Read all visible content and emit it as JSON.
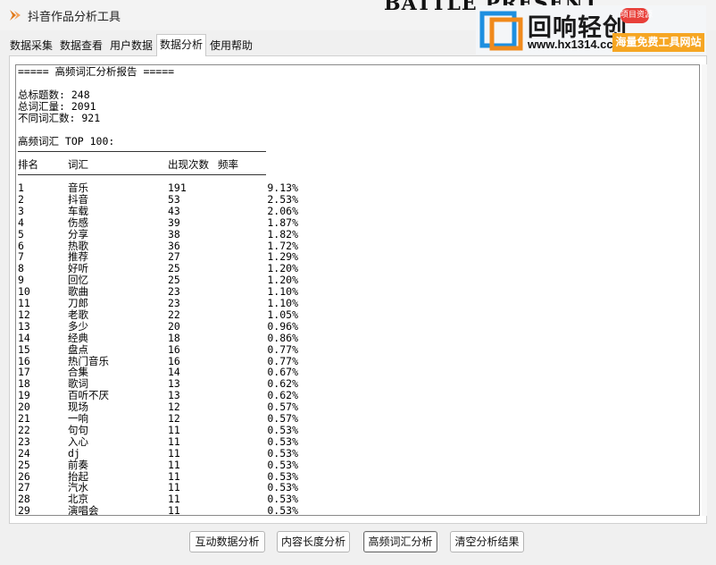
{
  "window": {
    "title": "抖音作品分析工具"
  },
  "background_partial_title": "BATTLE PRESENT",
  "tabs": [
    {
      "label": "数据采集",
      "active": false
    },
    {
      "label": "数据查看",
      "active": false
    },
    {
      "label": "用户数据",
      "active": false
    },
    {
      "label": "数据分析",
      "active": true
    },
    {
      "label": "使用帮助",
      "active": false
    }
  ],
  "banner": {
    "brand": "回响轻创",
    "badge": "项目资源",
    "url": "www.hx1314.cc",
    "slogan": "海量免费工具网站"
  },
  "report": {
    "heading": "===== 高频词汇分析报告 =====",
    "total_titles": "总标题数: 248",
    "total_words": "总词汇量: 2091",
    "unique_words": "不同词汇数: 921",
    "top_heading": "高频词汇 TOP 100:",
    "columns": {
      "rank": "排名",
      "word": "词汇",
      "count": "出现次数",
      "freq": "频率"
    },
    "rows": [
      {
        "rank": "1",
        "word": "音乐",
        "count": "191",
        "freq": "9.13%"
      },
      {
        "rank": "2",
        "word": "抖音",
        "count": "53",
        "freq": "2.53%"
      },
      {
        "rank": "3",
        "word": "车载",
        "count": "43",
        "freq": "2.06%"
      },
      {
        "rank": "4",
        "word": "伤感",
        "count": "39",
        "freq": "1.87%"
      },
      {
        "rank": "5",
        "word": "分享",
        "count": "38",
        "freq": "1.82%"
      },
      {
        "rank": "6",
        "word": "热歌",
        "count": "36",
        "freq": "1.72%"
      },
      {
        "rank": "7",
        "word": "推荐",
        "count": "27",
        "freq": "1.29%"
      },
      {
        "rank": "8",
        "word": "好听",
        "count": "25",
        "freq": "1.20%"
      },
      {
        "rank": "9",
        "word": "回忆",
        "count": "25",
        "freq": "1.20%"
      },
      {
        "rank": "10",
        "word": "歌曲",
        "count": "23",
        "freq": "1.10%"
      },
      {
        "rank": "11",
        "word": "刀郎",
        "count": "23",
        "freq": "1.10%"
      },
      {
        "rank": "12",
        "word": "老歌",
        "count": "22",
        "freq": "1.05%"
      },
      {
        "rank": "13",
        "word": "多少",
        "count": "20",
        "freq": "0.96%"
      },
      {
        "rank": "14",
        "word": "经典",
        "count": "18",
        "freq": "0.86%"
      },
      {
        "rank": "15",
        "word": "盘点",
        "count": "16",
        "freq": "0.77%"
      },
      {
        "rank": "16",
        "word": "热门音乐",
        "count": "16",
        "freq": "0.77%"
      },
      {
        "rank": "17",
        "word": "合集",
        "count": "14",
        "freq": "0.67%"
      },
      {
        "rank": "18",
        "word": "歌词",
        "count": "13",
        "freq": "0.62%"
      },
      {
        "rank": "19",
        "word": "百听不厌",
        "count": "13",
        "freq": "0.62%"
      },
      {
        "rank": "20",
        "word": "现场",
        "count": "12",
        "freq": "0.57%"
      },
      {
        "rank": "21",
        "word": "一响",
        "count": "12",
        "freq": "0.57%"
      },
      {
        "rank": "22",
        "word": "句句",
        "count": "11",
        "freq": "0.53%"
      },
      {
        "rank": "23",
        "word": "入心",
        "count": "11",
        "freq": "0.53%"
      },
      {
        "rank": "24",
        "word": "dj",
        "count": "11",
        "freq": "0.53%"
      },
      {
        "rank": "25",
        "word": "前奏",
        "count": "11",
        "freq": "0.53%"
      },
      {
        "rank": "26",
        "word": "抬起",
        "count": "11",
        "freq": "0.53%"
      },
      {
        "rank": "27",
        "word": "汽水",
        "count": "11",
        "freq": "0.53%"
      },
      {
        "rank": "28",
        "word": "北京",
        "count": "11",
        "freq": "0.53%"
      },
      {
        "rank": "29",
        "word": "演唱会",
        "count": "11",
        "freq": "0.53%"
      }
    ]
  },
  "buttons": {
    "interaction": "互动数据分析",
    "length": "内容长度分析",
    "frequency": "高频词汇分析",
    "clear": "清空分析结果"
  },
  "colors": {
    "logo_blue": "#1d8fe0",
    "logo_orange": "#f08a1c",
    "badge_red": "#e8403a",
    "slogan_orange": "#f6a623",
    "app_icon": "#e07a1c"
  },
  "icons": {
    "app": "app-logo-icon",
    "banner": "banner-logo-icon"
  }
}
